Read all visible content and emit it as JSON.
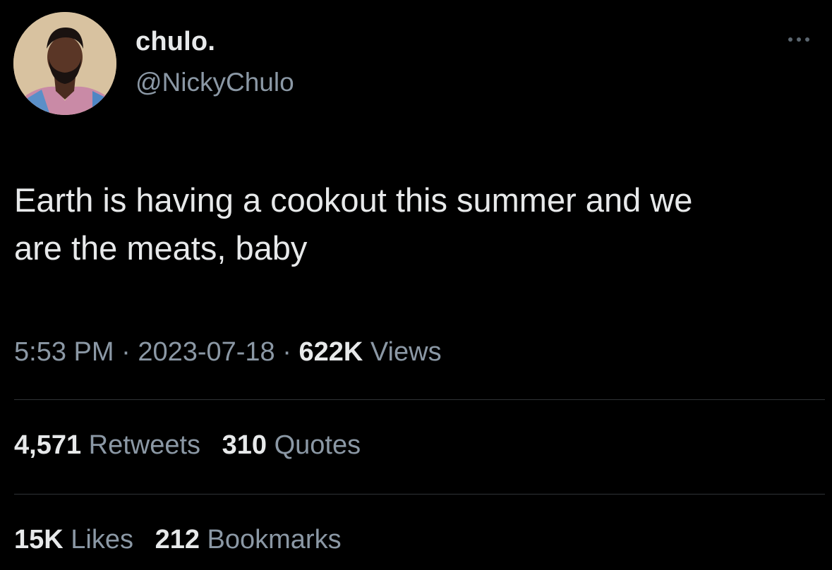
{
  "author": {
    "display_name": "chulo.",
    "handle": "@NickyChulo",
    "avatar_icon": "profile-photo"
  },
  "more_icon": "more-horizontal-icon",
  "tweet": {
    "text_line1": "Earth is having a cookout this summer and we",
    "text_line2": "are the meats, baby"
  },
  "meta": {
    "time": "5:53 PM",
    "sep1": " · ",
    "date": "2023-07-18",
    "sep2": " · ",
    "views_count": "622K",
    "views_label": " Views"
  },
  "engagement": {
    "retweets_count": "4,571",
    "retweets_label": " Retweets",
    "quotes_count": "310",
    "quotes_label": " Quotes",
    "likes_count": "15K",
    "likes_label": " Likes",
    "bookmarks_count": "212",
    "bookmarks_label": " Bookmarks"
  },
  "colors": {
    "background": "#000000",
    "primary_text": "#e7e9ea",
    "secondary_text": "#8b98a5",
    "divider": "#2f3336"
  }
}
